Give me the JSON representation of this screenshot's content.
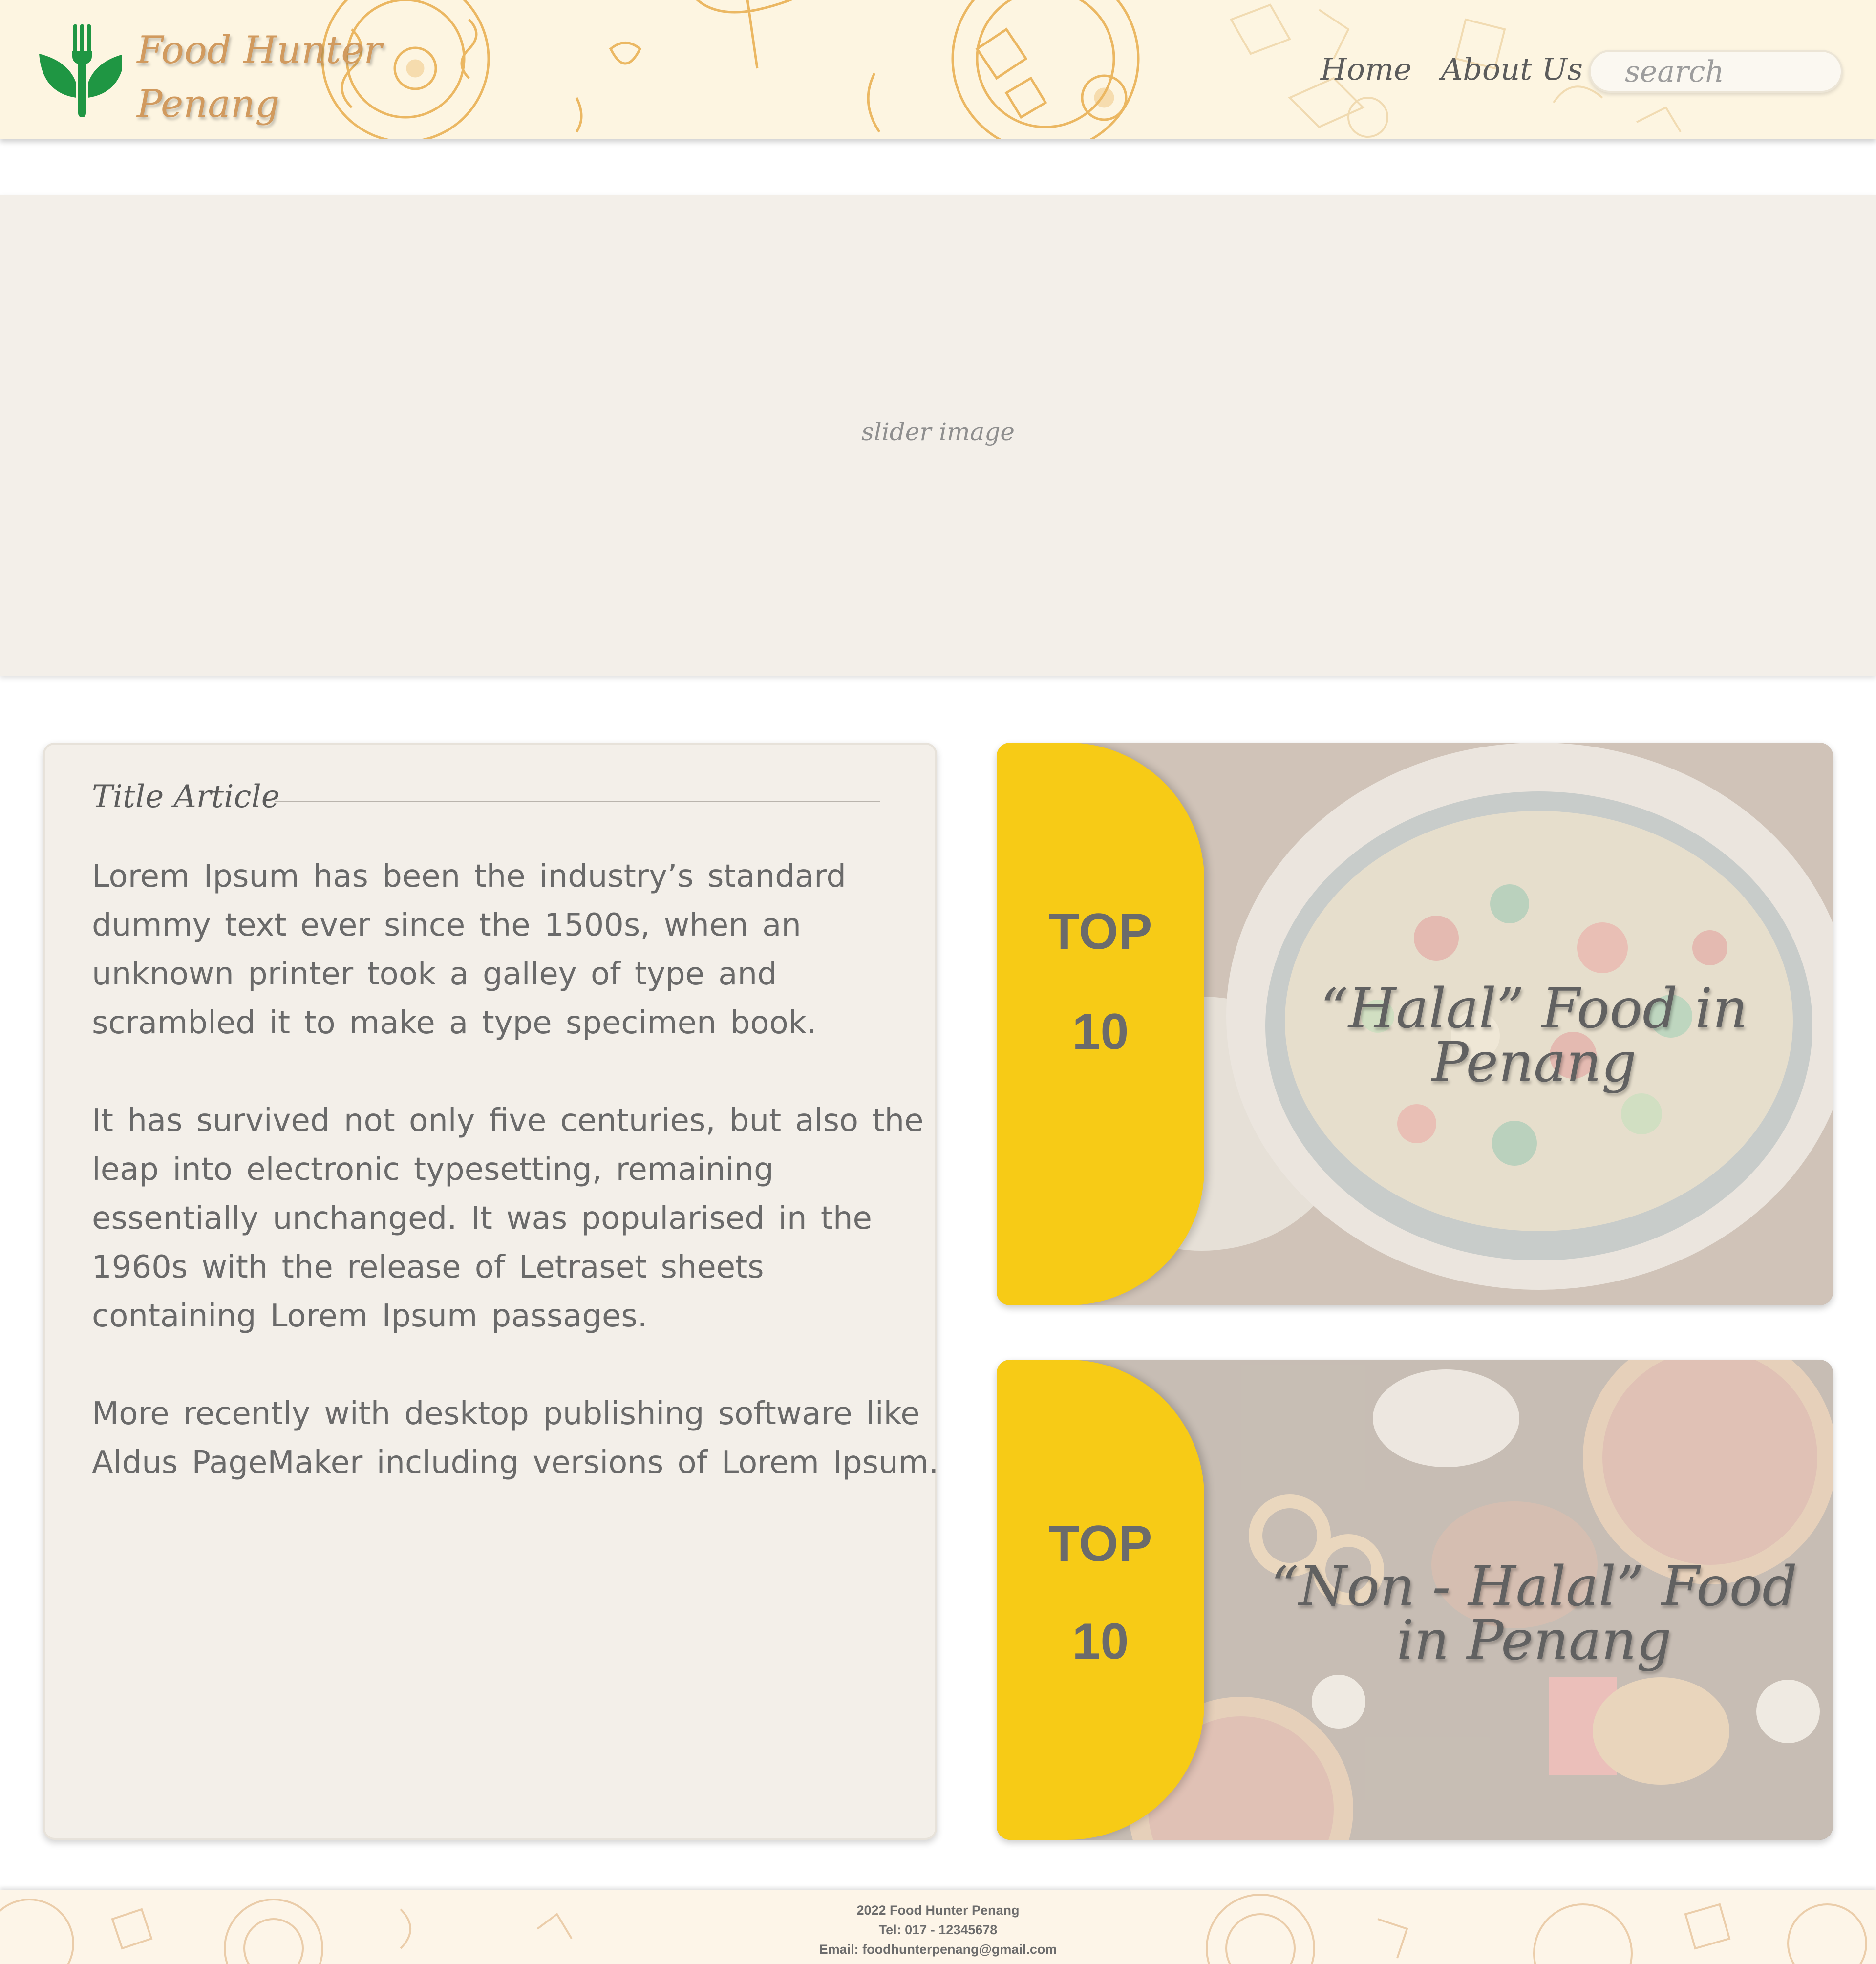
{
  "header": {
    "brand_line1": "Food Hunter",
    "brand_line2": "Penang",
    "nav": {
      "home": "Home",
      "about": "About Us"
    },
    "search_placeholder": "search",
    "logo_icon": "fork-leaf-logo-icon"
  },
  "slider": {
    "label": "slider image"
  },
  "article": {
    "title": "Title Article",
    "paragraphs": [
      "Lorem Ipsum has been the industry’s standard dummy text ever since the 1500s, when an unknown printer took a galley of type and scrambled it to make a type specimen book.",
      "It has survived not only five centuries, but also the leap into electronic typesetting, remaining essentially unchanged. It was popularised in the 1960s with the release of Letraset sheets containing Lorem Ipsum passages.",
      "More recently with desktop publishing software like Aldus PageMaker including versions of Lorem Ipsum."
    ]
  },
  "cards": [
    {
      "top": "TOP",
      "rank": "10",
      "title": "“Halal” Food in Penang"
    },
    {
      "top": "TOP",
      "rank": "10",
      "title": "“Non - Halal” Food in Penang"
    }
  ],
  "footer": {
    "line1": "2022 Food Hunter Penang",
    "line2": "Tel: 017 - 12345678",
    "line3": "Email: foodhunterpenang@gmail.com"
  },
  "colors": {
    "header_bg": "#fdf5e1",
    "brand": "#d19a5e",
    "logo_green": "#1f9643",
    "accent_yellow": "#f7cb16",
    "panel_bg": "#f3efe9",
    "doodle": "#e8ad4c"
  }
}
